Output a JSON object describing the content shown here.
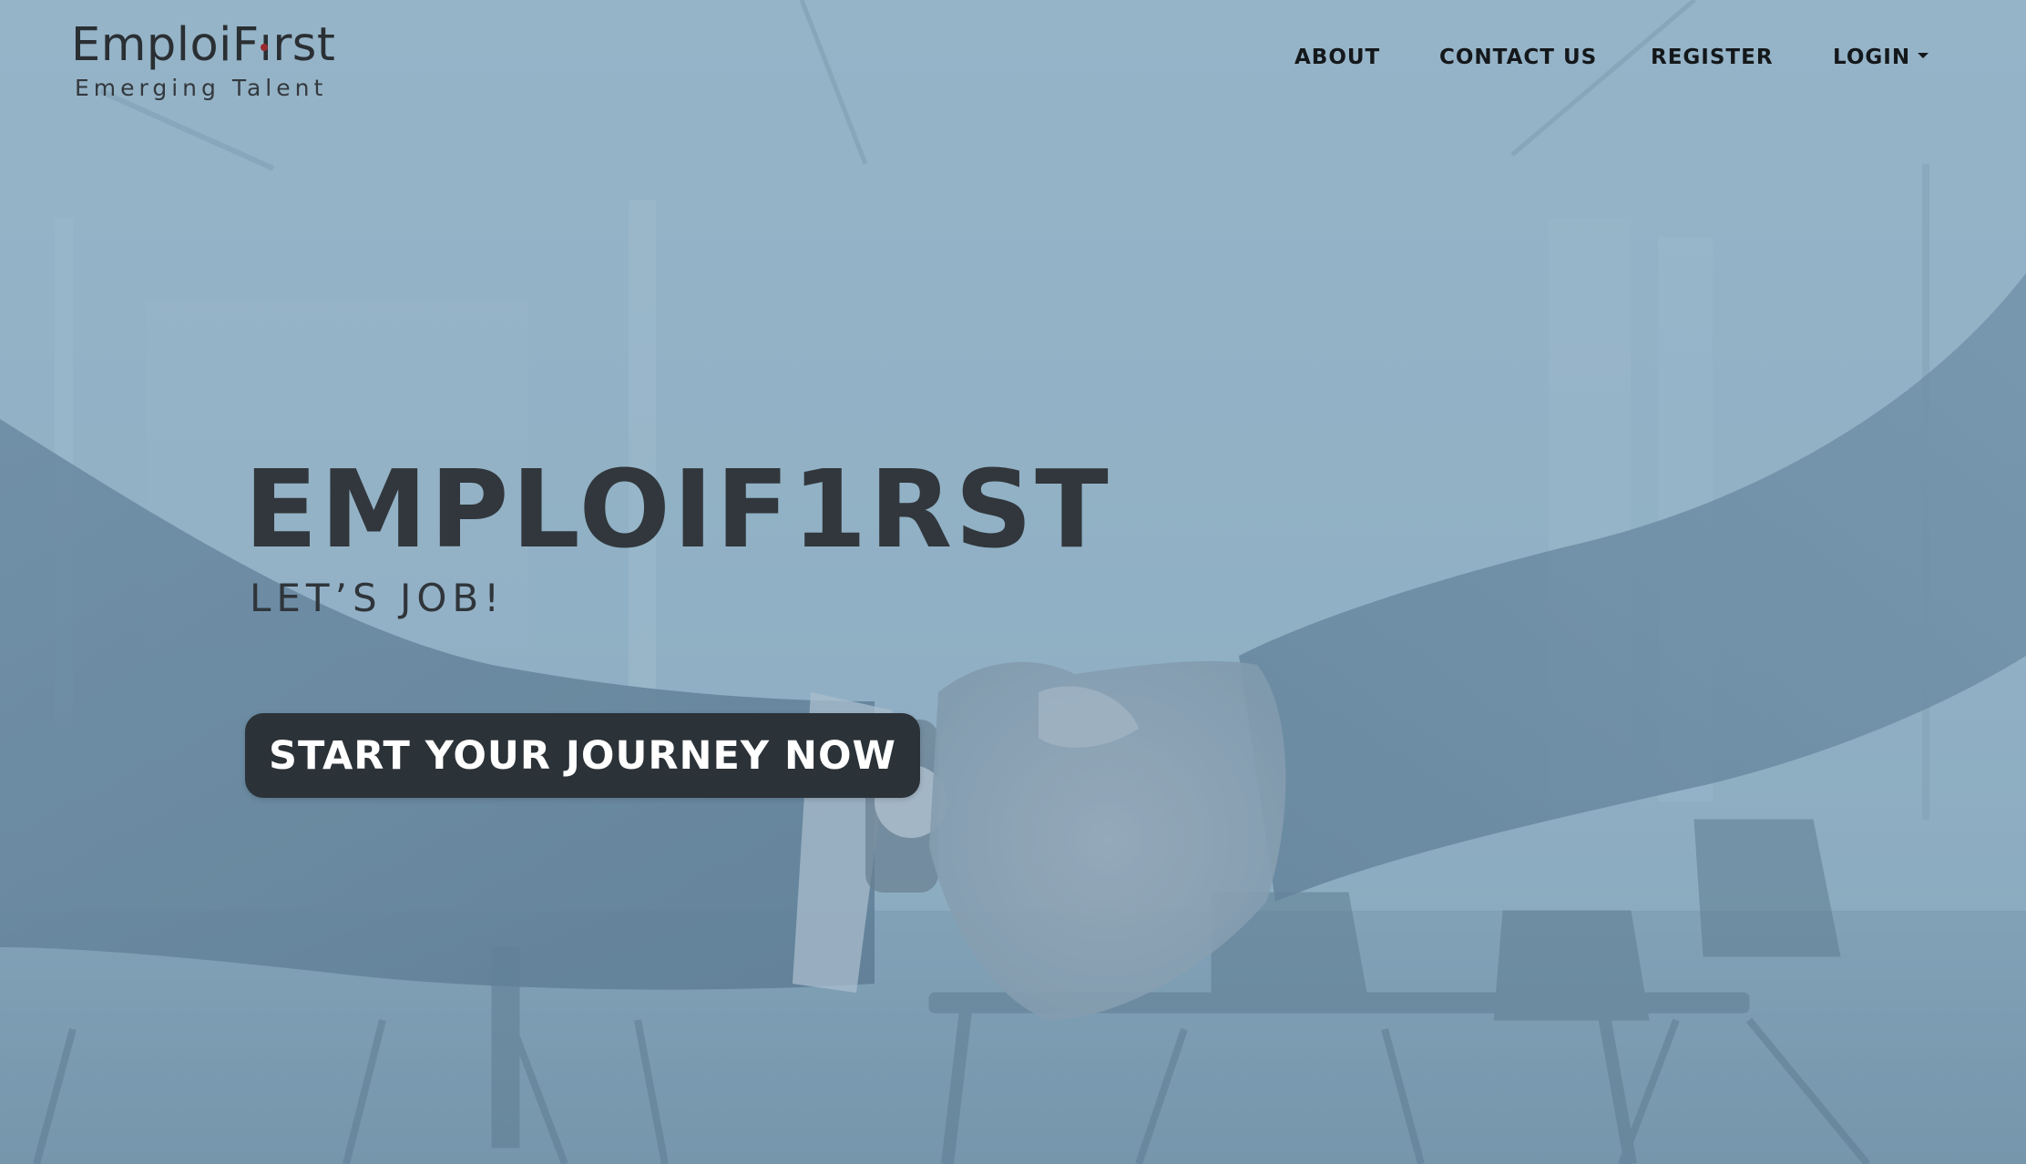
{
  "brand": {
    "logo_name": "EmploiFırst",
    "logo_tagline": "Emerging Talent"
  },
  "nav": {
    "about": "ABOUT",
    "contact": "CONTACT US",
    "register": "REGISTER",
    "login": "LOGIN"
  },
  "hero": {
    "title": "EMPLOIF1RST",
    "subtitle": "LET’S JOB!",
    "cta_label": "START YOUR JOURNEY NOW"
  },
  "colors": {
    "background_tint": "#93b3c6",
    "text_dark": "#31373c",
    "cta_background": "#2b3238",
    "cta_text": "#ffffff",
    "logo_accent": "#9a2a2f"
  },
  "icons": {
    "login_dropdown": "caret-down-icon"
  }
}
